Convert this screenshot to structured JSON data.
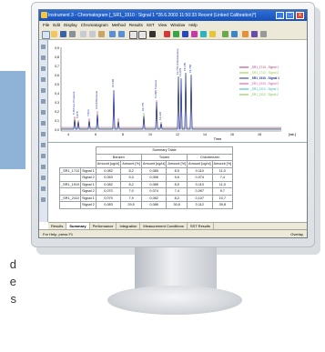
{
  "window": {
    "title": "Instrument 3 - Chromatogram [_SR1_1910 : Signal 1 *26.6.2003 11:50:33 Recent (Linked Calibration)*]",
    "minimize": "_",
    "maximize": "□",
    "close": "x"
  },
  "menu": [
    "File",
    "Edit",
    "Display",
    "Chromatogram",
    "Method",
    "Results",
    "SST",
    "View",
    "Window",
    "Help"
  ],
  "side_caption": [
    "d",
    "e",
    "s"
  ],
  "chart": {
    "peaks": [
      {
        "label": "5,456 Iso-Propanol"
      },
      {
        "label": "5,978"
      },
      {
        "label": "7,823"
      },
      {
        "label": "9,230 Benzene"
      },
      {
        "label": "10,006"
      },
      {
        "label": "10,775"
      },
      {
        "label": "11,895 Toluene"
      },
      {
        "label": "12,226"
      },
      {
        "label": "13,779 Chlorbenzene"
      },
      {
        "label": "13,979"
      },
      {
        "label": "15,155"
      },
      {
        "label": "15,750"
      }
    ],
    "yticks": [
      "0,0",
      "0,1",
      "0,2",
      "0,3",
      "0,4",
      "0,5",
      "0,6",
      "0,7",
      "0,8",
      "0,9"
    ],
    "xticks": [
      "4",
      "6",
      "8",
      "10",
      "12",
      "14",
      "16",
      "18"
    ],
    "xlabel": "Time",
    "xunit": "[min.]",
    "legend": [
      {
        "text": "_SR1_1710 - Signal 1",
        "color": "#c0306a"
      },
      {
        "text": "_SR1_1710 - Signal 2",
        "color": "#8ccf3a"
      },
      {
        "text": "_SR1_1910 - Signal 1",
        "color": "#1a2f9e"
      },
      {
        "text": "_SR1_1910 - Signal 2",
        "color": "#e24aa0"
      },
      {
        "text": "_SR1_2110 - Signal 1",
        "color": "#2bb8c4"
      },
      {
        "text": "_SR1_2110 - Signal 2",
        "color": "#7bc44a"
      }
    ]
  },
  "table": {
    "title": "Summary Table",
    "groups": [
      "Benzen",
      "Toluen",
      "Chlorbenzen"
    ],
    "subheaders": [
      "Amount [ug/ul]",
      "Amount [%]"
    ],
    "rows": [
      {
        "sample": "_SR1_1710",
        "signal": "Signal 1",
        "v": [
          "0,082",
          "8,2",
          "0,085",
          "8,5",
          "0,110",
          "11,0"
        ]
      },
      {
        "sample": "",
        "signal": "Signal 2",
        "v": [
          "0,053",
          "5,3",
          "0,056",
          "5,6",
          "0,074",
          "7,4"
        ]
      },
      {
        "sample": "_SR1_1910",
        "signal": "Signal 1",
        "v": [
          "0,082",
          "8,2",
          "0,085",
          "8,5",
          "0,110",
          "11,0"
        ]
      },
      {
        "sample": "",
        "signal": "Signal 2",
        "v": [
          "0,070",
          "7,0",
          "0,074",
          "7,4",
          "0,097",
          "9,7"
        ]
      },
      {
        "sample": "_SR1_2110",
        "signal": "Signal 1",
        "v": [
          "0,079",
          "7,9",
          "0,082",
          "8,2",
          "0,107",
          "10,7"
        ]
      },
      {
        "sample": "",
        "signal": "Signal 2",
        "v": [
          "0,083",
          "29,5",
          "0,086",
          "30,6",
          "0,112",
          "39,8"
        ]
      }
    ]
  },
  "tabs": [
    "Results",
    "Summary",
    "Performance",
    "Integration",
    "Measurement Conditions",
    "SST Results"
  ],
  "status": {
    "left": "For Help, press F1",
    "right": "Overlay"
  }
}
